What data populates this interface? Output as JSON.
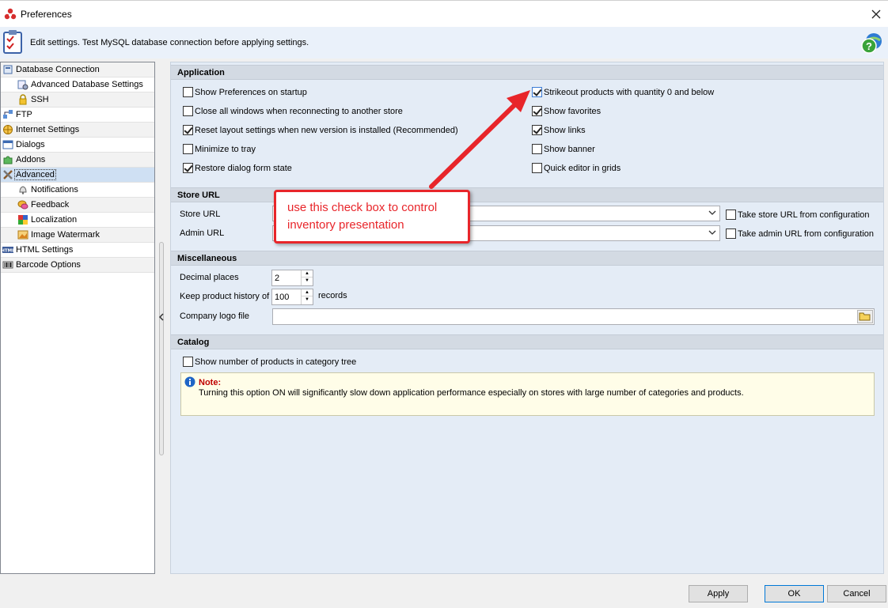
{
  "window": {
    "title": "Preferences"
  },
  "info": {
    "text": "Edit settings. Test MySQL database connection before applying settings."
  },
  "tree": {
    "items": [
      {
        "label": "Database Connection",
        "icon": "database-icon"
      },
      {
        "label": "Advanced Database Settings",
        "icon": "database-settings-icon"
      },
      {
        "label": "SSH",
        "icon": "lock-icon"
      },
      {
        "label": "FTP",
        "icon": "network-icon"
      },
      {
        "label": "Internet Settings",
        "icon": "globe-icon"
      },
      {
        "label": "Dialogs",
        "icon": "window-icon"
      },
      {
        "label": "Addons",
        "icon": "puzzle-icon"
      },
      {
        "label": "Advanced",
        "icon": "tools-icon"
      },
      {
        "label": "Notifications",
        "icon": "bell-icon"
      },
      {
        "label": "Feedback",
        "icon": "feedback-icon"
      },
      {
        "label": "Localization",
        "icon": "flags-icon"
      },
      {
        "label": "Image Watermark",
        "icon": "image-icon"
      },
      {
        "label": "HTML Settings",
        "icon": "html-icon"
      },
      {
        "label": "Barcode Options",
        "icon": "barcode-icon"
      }
    ]
  },
  "application": {
    "header": "Application",
    "left": [
      {
        "label": "Show Preferences on startup",
        "checked": false
      },
      {
        "label": "Close all windows when reconnecting to another store",
        "checked": false
      },
      {
        "label": "Reset layout settings when new version is installed (Recommended)",
        "checked": true
      },
      {
        "label": "Minimize to tray",
        "checked": false
      },
      {
        "label": "Restore dialog form state",
        "checked": true
      }
    ],
    "right": [
      {
        "label": "Strikeout products with quantity 0 and below",
        "checked": true
      },
      {
        "label": "Show favorites",
        "checked": true
      },
      {
        "label": "Show links",
        "checked": true
      },
      {
        "label": "Show banner",
        "checked": false
      },
      {
        "label": "Quick editor in grids",
        "checked": false
      }
    ]
  },
  "store_url": {
    "header": "Store URL",
    "store_label": "Store URL",
    "admin_label": "Admin URL",
    "take_store": "Take store URL from configuration",
    "take_admin": "Take admin URL from configuration"
  },
  "misc": {
    "header": "Miscellaneous",
    "decimal_label": "Decimal places",
    "decimal_value": "2",
    "history_label": "Keep product history of",
    "history_value": "100",
    "history_unit": "records",
    "logo_label": "Company logo file"
  },
  "catalog": {
    "header": "Catalog",
    "show_count": "Show number of products in category tree",
    "note_title": "Note:",
    "note_text": "Turning this option ON will significantly slow down application performance especially on stores with large number of categories and products."
  },
  "annotation": {
    "text": "use this check box to control inventory presentation",
    "color": "#e8252a"
  },
  "buttons": {
    "apply": "Apply",
    "ok": "OK",
    "cancel": "Cancel"
  }
}
